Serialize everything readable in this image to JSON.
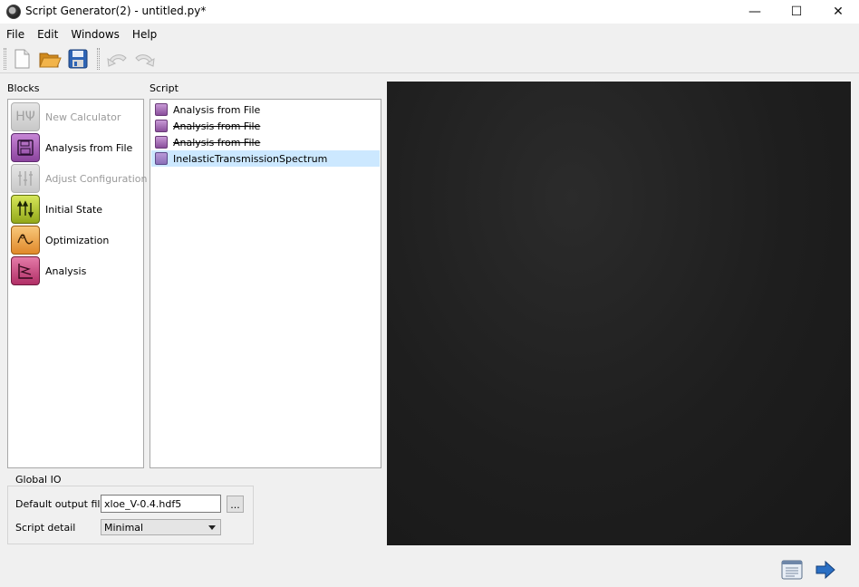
{
  "window": {
    "title": "Script Generator(2) - untitled.py*",
    "minimize_glyph": "—",
    "maximize_glyph": "☐",
    "close_glyph": "✕"
  },
  "menu": {
    "items": [
      "File",
      "Edit",
      "Windows",
      "Help"
    ]
  },
  "toolbar": {
    "buttons": [
      {
        "name": "new-file-icon",
        "enabled": true
      },
      {
        "name": "open-folder-icon",
        "enabled": true
      },
      {
        "name": "save-icon",
        "enabled": true
      },
      {
        "name": "undo-icon",
        "enabled": false
      },
      {
        "name": "redo-icon",
        "enabled": false
      }
    ]
  },
  "blocks": {
    "heading": "Blocks",
    "items": [
      {
        "label": "New Calculator",
        "icon": "calculator-icon",
        "enabled": false,
        "color": "#d0d0d0"
      },
      {
        "label": "Analysis from File",
        "icon": "floppy-icon",
        "enabled": true,
        "color": "#a55bb8"
      },
      {
        "label": "Adjust Configuration",
        "icon": "adjust-icon",
        "enabled": false,
        "color": "#d0d0d0"
      },
      {
        "label": "Initial State",
        "icon": "initial-state-icon",
        "enabled": true,
        "color": "#b5c92a"
      },
      {
        "label": "Optimization",
        "icon": "optimization-icon",
        "enabled": true,
        "color": "#f1a94c"
      },
      {
        "label": "Analysis",
        "icon": "analysis-icon",
        "enabled": true,
        "color": "#c9487e"
      }
    ]
  },
  "script": {
    "heading": "Script",
    "items": [
      {
        "label": "Analysis from File",
        "struck": false,
        "selected": false
      },
      {
        "label": "Analysis from File",
        "struck": true,
        "selected": false
      },
      {
        "label": "Analysis from File",
        "struck": true,
        "selected": false
      },
      {
        "label": "InelasticTransmissionSpectrum",
        "struck": false,
        "selected": true
      }
    ]
  },
  "global_io": {
    "title": "Global IO",
    "output_label": "Default output file",
    "output_value": "xloe_V-0.4.hdf5",
    "browse_label": "...",
    "detail_label": "Script detail",
    "detail_value": "Minimal"
  },
  "bottom": {
    "buttons": [
      "script-view-icon",
      "next-arrow-icon"
    ]
  },
  "colors": {
    "canvas_bg": "#1e1e1e",
    "selection": "#cce8ff",
    "accent_blue": "#2a7fd0"
  }
}
